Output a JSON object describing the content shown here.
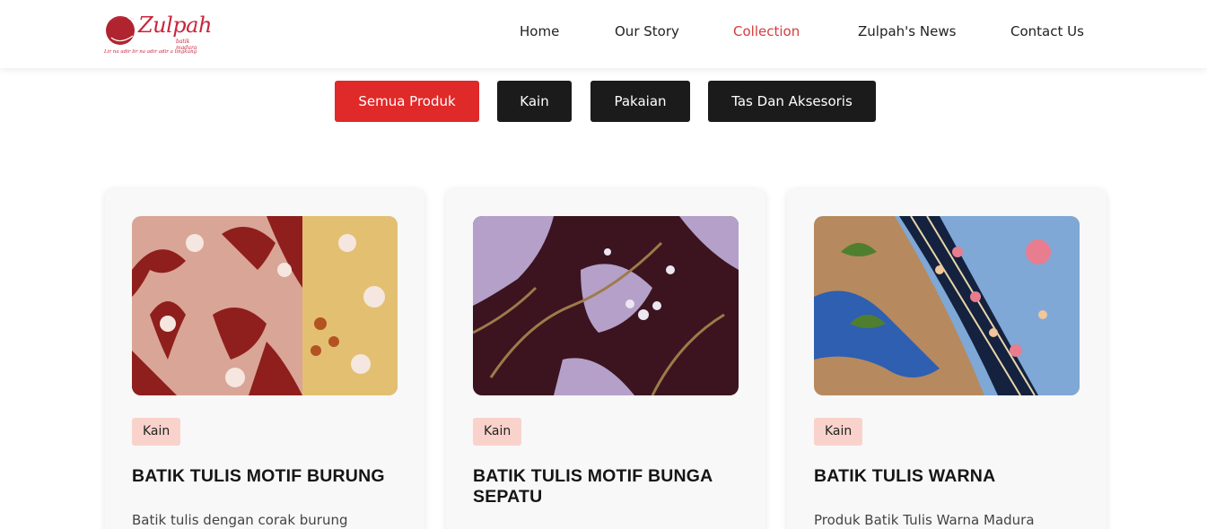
{
  "brand": {
    "name": "Zulpah",
    "sub": "batik madura",
    "tagline": "Lir na adir lir na adir adir a lingkung"
  },
  "nav": {
    "items": [
      "Home",
      "Our Story",
      "Collection",
      "Zulpah's News",
      "Contact Us"
    ],
    "active": "Collection"
  },
  "filters": {
    "items": [
      "Semua Produk",
      "Kain",
      "Pakaian",
      "Tas Dan Aksesoris"
    ],
    "active": "Semua Produk"
  },
  "products": [
    {
      "tag": "Kain",
      "title": "BATIK TULIS MOTIF BURUNG",
      "desc": "Batik tulis dengan corak burung",
      "image": "batik-bird-motif-red"
    },
    {
      "tag": "Kain",
      "title": "BATIK TULIS MOTIF BUNGA SEPATU",
      "desc": "",
      "image": "batik-hibiscus-motif-purple"
    },
    {
      "tag": "Kain",
      "title": "BATIK TULIS WARNA",
      "desc": "Produk Batik Tulis Warna Madura",
      "image": "batik-color-motif-blue"
    }
  ],
  "colors": {
    "accent": "#e02929",
    "nav_active": "#d83b3b",
    "button_dark": "#1b1b1b",
    "tag_bg": "#f9d3cb",
    "brand": "#c9243a"
  }
}
